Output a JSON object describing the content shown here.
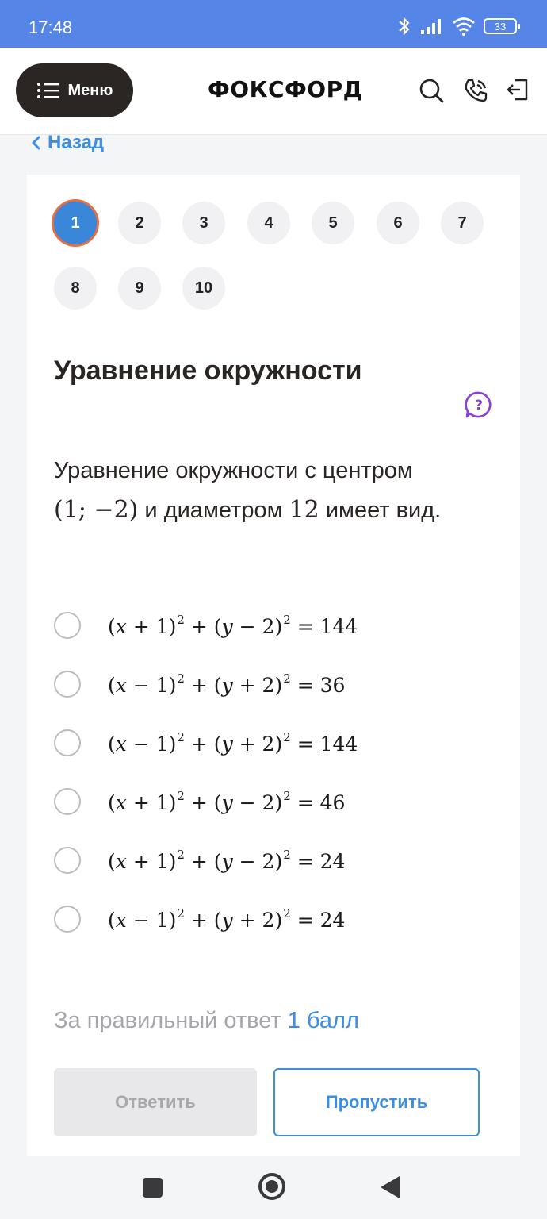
{
  "status_bar": {
    "time": "17:48",
    "battery": "33"
  },
  "header": {
    "menu_label": "Меню",
    "logo": "ФОКСФОРД"
  },
  "back_label": "Назад",
  "questions": [
    "1",
    "2",
    "3",
    "4",
    "5",
    "6",
    "7",
    "8",
    "9",
    "10"
  ],
  "active_question": "1",
  "task": {
    "title": "Уравнение окружности",
    "text_part1": "Уравнение окружности с центром",
    "center": "(1; −2)",
    "text_part2": " и диаметром ",
    "diameter": "12",
    "text_part3": " имеет вид."
  },
  "options": [
    {
      "a": "+",
      "b": "1",
      "c": "−",
      "d": "2",
      "rhs": "144"
    },
    {
      "a": "−",
      "b": "1",
      "c": "+",
      "d": "2",
      "rhs": "36"
    },
    {
      "a": "−",
      "b": "1",
      "c": "+",
      "d": "2",
      "rhs": "144"
    },
    {
      "a": "+",
      "b": "1",
      "c": "−",
      "d": "2",
      "rhs": "46"
    },
    {
      "a": "+",
      "b": "1",
      "c": "−",
      "d": "2",
      "rhs": "24"
    },
    {
      "a": "−",
      "b": "1",
      "c": "+",
      "d": "2",
      "rhs": "24"
    }
  ],
  "points": {
    "label": "За правильный ответ ",
    "value": "1 балл"
  },
  "buttons": {
    "answer": "Ответить",
    "skip": "Пропустить"
  },
  "colors": {
    "status_bar": "#5585e6",
    "accent": "#3d8ee0",
    "active_ring": "#e46f45",
    "menu_bg": "#2b2523"
  },
  "icons": [
    "bluetooth-icon",
    "signal-icon",
    "wifi-icon",
    "battery-icon",
    "menu-icon",
    "search-icon",
    "phone-icon",
    "logout-icon",
    "chevron-left-icon",
    "help-bubble-icon"
  ]
}
